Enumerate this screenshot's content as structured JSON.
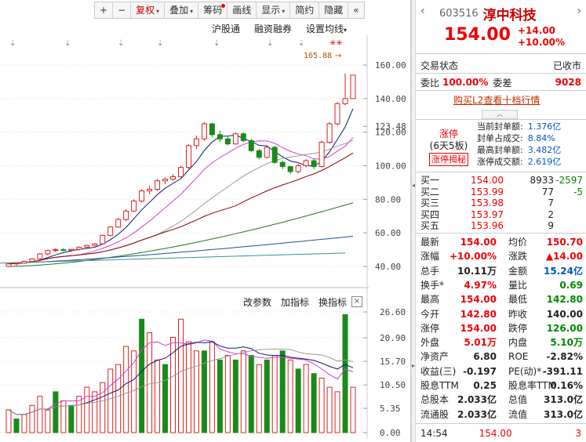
{
  "toolbar": {
    "plus": "+",
    "minus": "−",
    "fq": "复权",
    "overlay": "叠加",
    "chips": "筹码",
    "draw": "画线",
    "display": "显示",
    "simple": "简约",
    "hide": "隐藏",
    "collapse_icon": "«"
  },
  "subbar": {
    "hgt": "沪股通",
    "margin": "融资融券",
    "settings": "设置均线"
  },
  "indbar": {
    "params": "改参数",
    "add": "加指标",
    "switch": "换指标",
    "close": "×"
  },
  "chart_data": {
    "type": "candlestick",
    "price_axis": [
      "160.00",
      "140.00",
      "123.48",
      "120.00",
      "100.00",
      "80.00",
      "60.00",
      "40.00"
    ],
    "vol_axis": [
      "26.60",
      "20.90",
      "15.70",
      "10.50",
      "5.35",
      "0.00"
    ],
    "high_label": "165.88",
    "ohlc": [
      [
        40,
        42,
        39.5,
        41.5
      ],
      [
        41.5,
        42.5,
        40.5,
        42
      ],
      [
        42,
        43.5,
        41.5,
        43
      ],
      [
        43,
        45,
        42.5,
        44.5
      ],
      [
        44.5,
        48,
        44,
        47.5
      ],
      [
        47.5,
        50,
        46.5,
        49.5
      ],
      [
        49.5,
        51,
        48.5,
        50
      ],
      [
        50,
        51,
        49,
        49.6
      ],
      [
        49.6,
        50.5,
        48.8,
        50.2
      ],
      [
        50.2,
        52,
        49.5,
        51.5
      ],
      [
        51.5,
        53,
        51,
        52.5
      ],
      [
        52.5,
        54,
        52,
        53.5
      ],
      [
        53.5,
        59,
        53,
        58.5
      ],
      [
        58.5,
        64,
        58,
        63.5
      ],
      [
        63.5,
        69,
        63,
        68
      ],
      [
        68,
        74,
        67,
        73
      ],
      [
        73,
        80,
        72.5,
        79
      ],
      [
        79,
        86,
        78,
        85
      ],
      [
        85,
        88,
        83,
        86
      ],
      [
        86,
        92,
        85,
        91
      ],
      [
        91,
        93,
        89,
        92
      ],
      [
        92,
        95,
        91,
        93.5
      ],
      [
        93.5,
        100,
        93,
        99
      ],
      [
        99,
        113,
        98,
        112
      ],
      [
        112,
        118,
        110,
        116
      ],
      [
        116,
        126,
        115,
        125
      ],
      [
        125,
        125.5,
        117,
        118.5
      ],
      [
        118.5,
        121,
        114,
        116
      ],
      [
        116,
        118,
        112,
        113
      ],
      [
        113,
        120,
        112.5,
        119
      ],
      [
        119,
        120,
        114,
        115
      ],
      [
        115,
        116,
        108,
        109
      ],
      [
        109,
        110,
        104,
        105
      ],
      [
        105,
        112,
        104.5,
        111
      ],
      [
        111,
        112,
        101,
        102
      ],
      [
        102,
        103,
        98,
        99.5
      ],
      [
        99.5,
        100,
        95,
        96.5
      ],
      [
        96.5,
        101,
        95.5,
        100
      ],
      [
        100,
        104,
        99,
        103
      ],
      [
        103,
        104,
        98,
        99.5
      ],
      [
        99.5,
        115,
        99,
        114
      ],
      [
        114,
        126,
        113,
        125
      ],
      [
        125,
        138,
        124,
        137
      ],
      [
        137,
        155,
        136,
        140
      ],
      [
        140,
        154,
        140,
        154
      ]
    ],
    "volume": [
      [
        5,
        "r"
      ],
      [
        3,
        "g"
      ],
      [
        4,
        "r"
      ],
      [
        6,
        "r"
      ],
      [
        8,
        "r"
      ],
      [
        5,
        "r"
      ],
      [
        9,
        "g"
      ],
      [
        7,
        "r"
      ],
      [
        6,
        "g"
      ],
      [
        8,
        "r"
      ],
      [
        10,
        "r"
      ],
      [
        9,
        "r"
      ],
      [
        11,
        "r"
      ],
      [
        14,
        "r"
      ],
      [
        15,
        "r"
      ],
      [
        19,
        "r"
      ],
      [
        18,
        "r"
      ],
      [
        25,
        "g"
      ],
      [
        22,
        "r"
      ],
      [
        16,
        "r"
      ],
      [
        15,
        "g"
      ],
      [
        21,
        "r"
      ],
      [
        25,
        "r"
      ],
      [
        20,
        "r"
      ],
      [
        18,
        "r"
      ],
      [
        18,
        "g"
      ],
      [
        20,
        "r"
      ],
      [
        16,
        "g"
      ],
      [
        17,
        "r"
      ],
      [
        16,
        "g"
      ],
      [
        18,
        "r"
      ],
      [
        17,
        "g"
      ],
      [
        15,
        "r"
      ],
      [
        16,
        "g"
      ],
      [
        17,
        "r"
      ],
      [
        18,
        "g"
      ],
      [
        16,
        "r"
      ],
      [
        14,
        "g"
      ],
      [
        15,
        "r"
      ],
      [
        13,
        "g"
      ],
      [
        12,
        "r"
      ],
      [
        10,
        "r"
      ],
      [
        9,
        "r"
      ],
      [
        26,
        "g"
      ],
      [
        10,
        "r"
      ]
    ]
  },
  "quote": {
    "code": "603516",
    "name": "淳中科技",
    "price": "154.00",
    "chg": "+14.00",
    "pct": "+10.00%",
    "status_label": "交易状态",
    "status_value": "已收市",
    "wb_label": "委比",
    "wb_value": "100.00%",
    "wc_label": "委差",
    "wc_value": "9028",
    "l2_link": "购买L2查看十档行情",
    "collapse_icon": "︿",
    "limit_title": "涨停",
    "limit_days": "(6天5板)",
    "limit_btn": "涨停揭秘",
    "seal": [
      {
        "k": "当前封单额:",
        "v": "1.376亿"
      },
      {
        "k": "封单占成交:",
        "v": "8.84%"
      },
      {
        "k": "最高封单额:",
        "v": "3.482亿"
      },
      {
        "k": "涨停成交额:",
        "v": "2.619亿"
      }
    ],
    "bids": [
      {
        "l": "买一",
        "p": "154.00",
        "v": "8933",
        "d": "-2597"
      },
      {
        "l": "买二",
        "p": "153.99",
        "v": "77",
        "d": "-5"
      },
      {
        "l": "买三",
        "p": "153.98",
        "v": "7",
        "d": ""
      },
      {
        "l": "买四",
        "p": "153.97",
        "v": "2",
        "d": ""
      },
      {
        "l": "买五",
        "p": "153.96",
        "v": "9",
        "d": ""
      }
    ],
    "stats": [
      {
        "a": "最新",
        "av": "154.00",
        "b": "均价",
        "bv": "150.70"
      },
      {
        "a": "涨幅",
        "av": "+10.00%",
        "b": "涨跌",
        "bv": "▲14.00"
      },
      {
        "a": "总手",
        "av": "10.11万",
        "b": "金额",
        "bv": "15.24亿"
      },
      {
        "a": "换手*",
        "av": "4.97%",
        "b": "量比",
        "bv": "0.69"
      },
      {
        "a": "最高",
        "av": "154.00",
        "b": "最低",
        "bv": "142.80"
      },
      {
        "a": "今开",
        "av": "142.80",
        "b": "昨收",
        "bv": "140.00"
      },
      {
        "a": "涨停",
        "av": "154.00",
        "b": "跌停",
        "bv": "126.00"
      },
      {
        "a": "外盘",
        "av": "5.01万",
        "b": "内盘",
        "bv": "5.10万"
      },
      {
        "a": "净资产",
        "av": "6.80",
        "b": "ROE",
        "bv": "-2.82%"
      },
      {
        "a": "收益(三)",
        "av": "-0.197",
        "b": "PE(动)*",
        "bv": "-391.11"
      },
      {
        "a": "股息TTM",
        "av": "0.25",
        "b": "股息率TTM",
        "bv": "0.16%"
      },
      {
        "a": "总股本",
        "av": "2.033亿",
        "b": "总值",
        "bv": "313.0亿"
      },
      {
        "a": "流通股",
        "av": "2.033亿",
        "b": "流值",
        "bv": "313.0亿"
      }
    ],
    "tick_time": "14:54",
    "tick_price": "154.00",
    "tick_vol": "3"
  }
}
